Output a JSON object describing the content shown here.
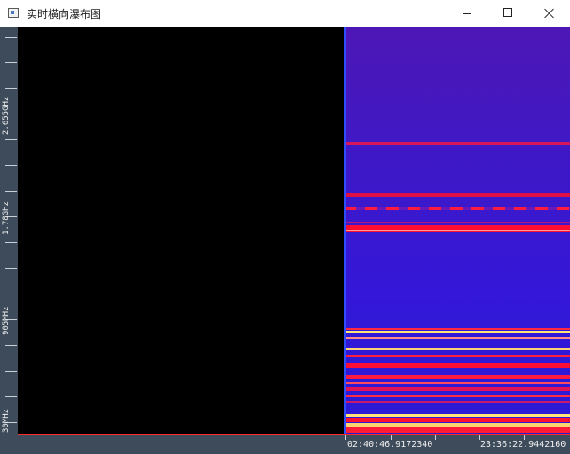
{
  "window": {
    "title": "实时横向瀑布图",
    "icon": "app-window-icon",
    "controls": {
      "minimize": "minimize-icon",
      "maximize": "maximize-icon",
      "close": "close-icon"
    }
  },
  "frequency_axis": {
    "labels": [
      "2.655GHz",
      "1.78GHz",
      "905MHz",
      "30MHz"
    ]
  },
  "time_axis": {
    "labels": [
      "02:40:46.9172340",
      "23:36:22.9442160"
    ]
  },
  "colors": {
    "background": "#000000",
    "cursor": "#ff2a2a",
    "axis_panel": "#3d4b5a",
    "waterfall_low": "#3417d8",
    "waterfall_high": "#ff0033",
    "waterfall_peak": "#ffe27a"
  }
}
